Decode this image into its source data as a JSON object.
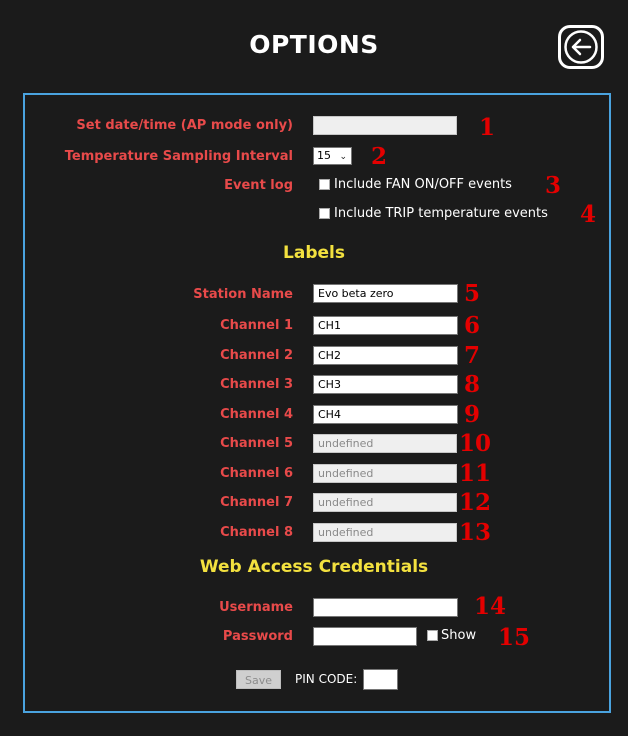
{
  "header": {
    "title": "OPTIONS",
    "back_icon": "arrow-left-circle-icon"
  },
  "general": {
    "datetime": {
      "label": "Set date/time (AP mode only)",
      "value": "",
      "number": "1"
    },
    "sampling": {
      "label": "Temperature Sampling Interval",
      "value": "15",
      "number": "2"
    },
    "event_log": {
      "label": "Event log",
      "fan": {
        "label": "Include FAN ON/OFF events",
        "checked": false,
        "number": "3"
      },
      "trip": {
        "label": "Include TRIP temperature events",
        "checked": false,
        "number": "4"
      }
    }
  },
  "labels": {
    "heading": "Labels",
    "station": {
      "label": "Station Name",
      "value": "Evo beta zero",
      "number": "5"
    },
    "channels": [
      {
        "label": "Channel 1",
        "value": "CH1",
        "number": "6",
        "enabled": true
      },
      {
        "label": "Channel 2",
        "value": "CH2",
        "number": "7",
        "enabled": true
      },
      {
        "label": "Channel 3",
        "value": "CH3",
        "number": "8",
        "enabled": true
      },
      {
        "label": "Channel 4",
        "value": "CH4",
        "number": "9",
        "enabled": true
      },
      {
        "label": "Channel 5",
        "value": "undefined",
        "number": "10",
        "enabled": false
      },
      {
        "label": "Channel 6",
        "value": "undefined",
        "number": "11",
        "enabled": false
      },
      {
        "label": "Channel 7",
        "value": "undefined",
        "number": "12",
        "enabled": false
      },
      {
        "label": "Channel 8",
        "value": "undefined",
        "number": "13",
        "enabled": false
      }
    ]
  },
  "credentials": {
    "heading": "Web Access Credentials",
    "username": {
      "label": "Username",
      "value": "",
      "number": "14"
    },
    "password": {
      "label": "Password",
      "value": "",
      "number": "15",
      "show_label": "Show",
      "show_checked": false
    }
  },
  "footer": {
    "save_label": "Save",
    "pin_label": "PIN CODE:",
    "pin_value": ""
  },
  "colors": {
    "background": "#1b1b1b",
    "label": "#e84a4a",
    "heading": "#f3e13f",
    "number": "#e40000",
    "border": "#4aa3df"
  }
}
